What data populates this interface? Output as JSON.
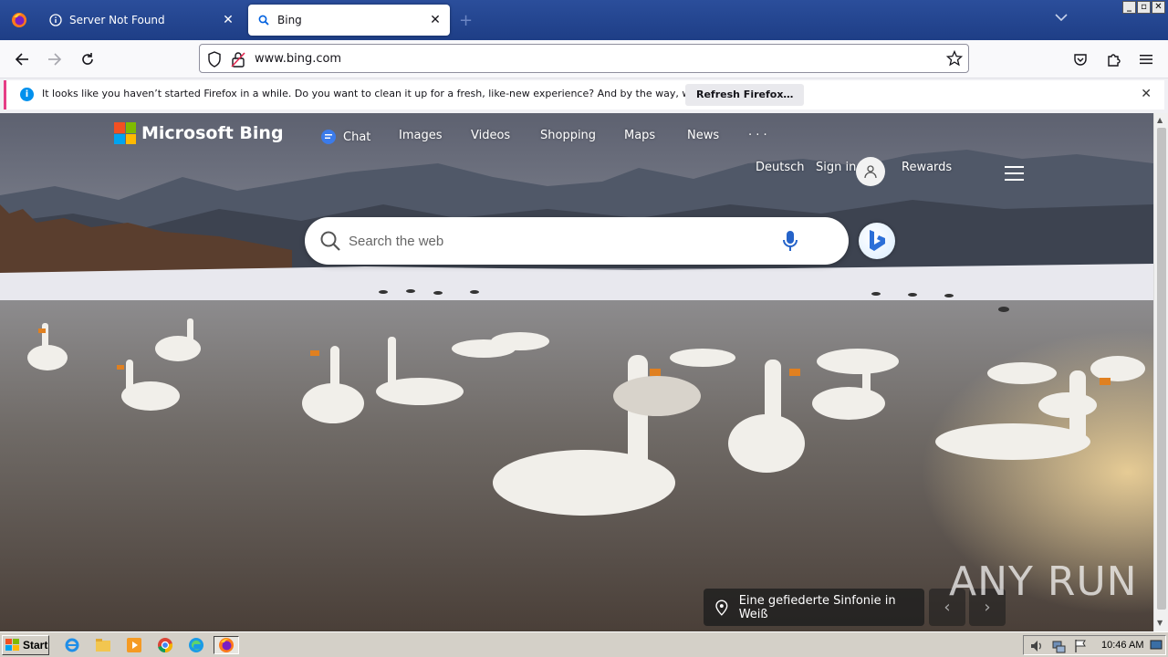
{
  "browser": {
    "tabs": [
      {
        "title": "Server Not Found",
        "icon": "info-icon",
        "active": false
      },
      {
        "title": "Bing",
        "icon": "search-icon",
        "active": true
      }
    ],
    "url": "www.bing.com"
  },
  "notification": {
    "message": "It looks like you haven’t started Firefox in a while. Do you want to clean it up for a fresh, like-new experience? And by the way, welcome back!",
    "button_label": "Refresh Firefox…"
  },
  "bing": {
    "logo_text": "Microsoft Bing",
    "nav": [
      "Chat",
      "Images",
      "Videos",
      "Shopping",
      "Maps",
      "News",
      "· · ·"
    ],
    "language": "Deutsch",
    "sign_in": "Sign in",
    "rewards": "Rewards",
    "search_placeholder": "Search the web",
    "image_caption": "Eine gefiederte Sinfonie in Weiß"
  },
  "watermark": "ANY RUN",
  "taskbar": {
    "start_label": "Start",
    "clock": "10:46 AM"
  },
  "colors": {
    "tabstrip": "#1e3e86",
    "notification_accent": "#e63d86",
    "bing_chat": "#3b7bea"
  }
}
